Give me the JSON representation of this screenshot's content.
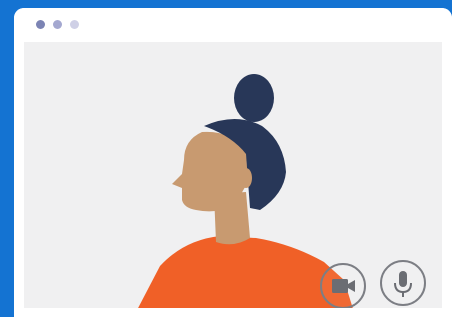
{
  "window": {
    "controls": [
      "window-dot-1",
      "window-dot-2",
      "window-dot-3"
    ]
  },
  "call": {
    "buttons": [
      {
        "name": "camera-button",
        "icon": "video-camera-icon"
      },
      {
        "name": "microphone-button",
        "icon": "microphone-icon"
      }
    ]
  },
  "colors": {
    "background": "#1473d2",
    "video_area": "#f0f0f1",
    "hair": "#283758",
    "skin": "#c89a70",
    "shirt": "#f06027",
    "control_stroke": "#7c7e84"
  }
}
